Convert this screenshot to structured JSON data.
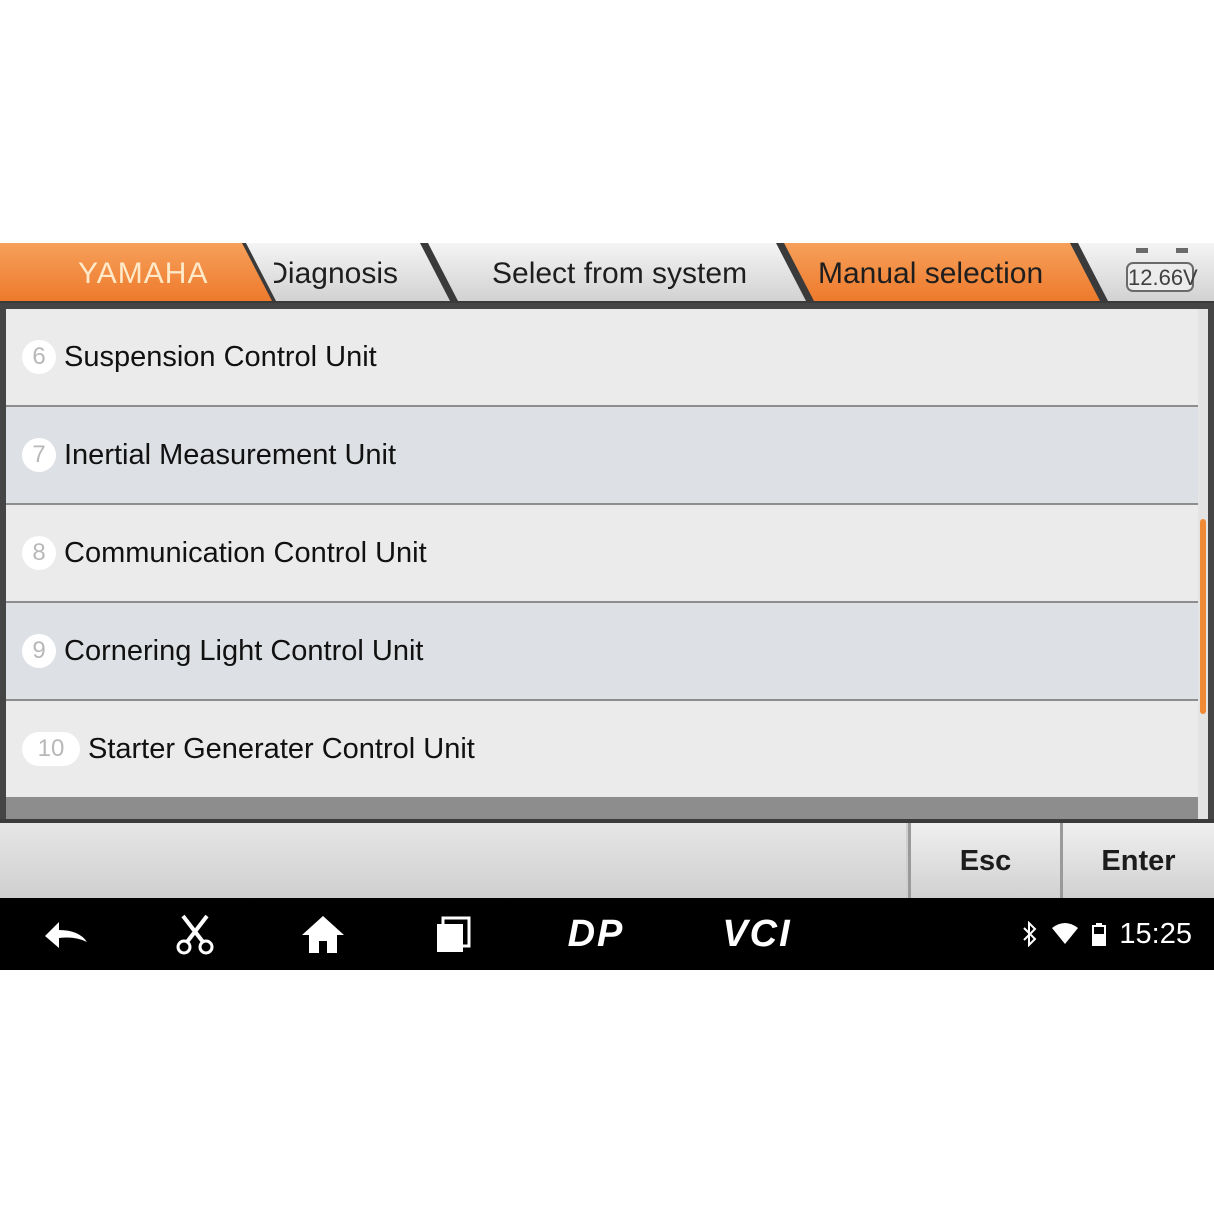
{
  "breadcrumb": {
    "brand": "YAMAHA",
    "step2": "Diagnosis",
    "step3": "Select from system",
    "step4": "Manual selection"
  },
  "battery_voltage": "12.66V",
  "colors": {
    "accent": "#f0853a",
    "tab_gray": "#dcdcdc",
    "row_light": "#ebebeb",
    "row_dark": "#dde0e5"
  },
  "list": {
    "items": [
      {
        "number": "6",
        "label": "Suspension Control Unit"
      },
      {
        "number": "7",
        "label": "Inertial Measurement Unit"
      },
      {
        "number": "8",
        "label": "Communication Control Unit"
      },
      {
        "number": "9",
        "label": "Cornering Light Control Unit"
      },
      {
        "number": "10",
        "label": "Starter Generater Control Unit"
      }
    ]
  },
  "actions": {
    "esc_label": "Esc",
    "enter_label": "Enter"
  },
  "navbar": {
    "icons": [
      "back-icon",
      "scissors-icon",
      "home-icon",
      "recent-apps-icon"
    ],
    "dp_label": "DP",
    "vci_label": "VCI"
  },
  "status": {
    "icons": [
      "bluetooth-icon",
      "wifi-icon",
      "battery-icon"
    ],
    "time": "15:25"
  }
}
